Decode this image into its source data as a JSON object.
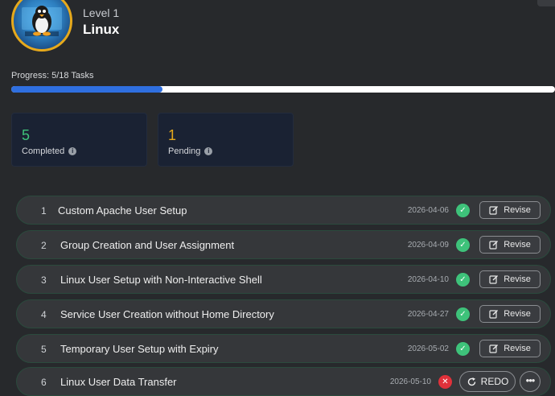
{
  "header": {
    "level": "Level 1",
    "course": "Linux"
  },
  "progress": {
    "label": "Progress: 5/18 Tasks",
    "completed": 5,
    "total": 18
  },
  "stats": {
    "completed": {
      "value": "5",
      "label": "Completed",
      "color": "#3ec27a"
    },
    "pending": {
      "value": "1",
      "label": "Pending",
      "color": "#e6a91c"
    }
  },
  "tasks": [
    {
      "index": "1",
      "title": "Custom Apache User Setup",
      "date": "2026-04-06",
      "status": "done",
      "action": "Revise"
    },
    {
      "index": "2",
      "title": "Group Creation and User Assignment",
      "date": "2026-04-09",
      "status": "done",
      "action": "Revise"
    },
    {
      "index": "3",
      "title": "Linux User Setup with Non-Interactive Shell",
      "date": "2026-04-10",
      "status": "done",
      "action": "Revise"
    },
    {
      "index": "4",
      "title": "Service User Creation without Home Directory",
      "date": "2026-04-27",
      "status": "done",
      "action": "Revise"
    },
    {
      "index": "5",
      "title": "Temporary User Setup with Expiry",
      "date": "2026-05-02",
      "status": "done",
      "action": "Revise"
    },
    {
      "index": "6",
      "title": "Linux User Data Transfer",
      "date": "2026-05-10",
      "status": "failed",
      "action": "REDO"
    }
  ],
  "icons": {
    "status_done": "check-icon",
    "status_failed": "close-icon",
    "revise": "edit-icon",
    "redo": "redo-icon",
    "more": "more-icon",
    "info": "info-icon"
  }
}
